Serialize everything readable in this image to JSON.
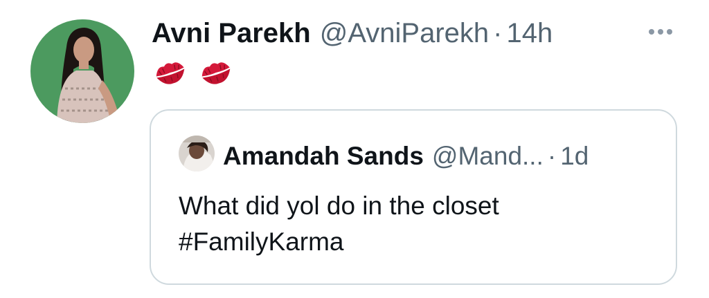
{
  "tweet": {
    "author": {
      "display_name": "Avni Parekh",
      "handle": "@AvniParekh",
      "separator": "·",
      "time": "14h",
      "avatar_icon": "user-avatar-photo"
    },
    "more_icon": "more-horizontal-icon",
    "body_emoji": [
      "kiss-mark-emoji",
      "kiss-mark-emoji"
    ],
    "quoted": {
      "display_name": "Amandah Sands",
      "handle": "@Mand...",
      "separator": "·",
      "time": "1d",
      "text_line1": "What did yol do in the closet",
      "text_line2": "#FamilyKarma",
      "avatar_icon": "user-avatar-photo"
    }
  },
  "colors": {
    "text_primary": "#0f1419",
    "text_secondary": "#536471",
    "border": "#cfd9de",
    "avatar_bg": "#4c9a5f",
    "emoji_red": "#d4193a"
  }
}
